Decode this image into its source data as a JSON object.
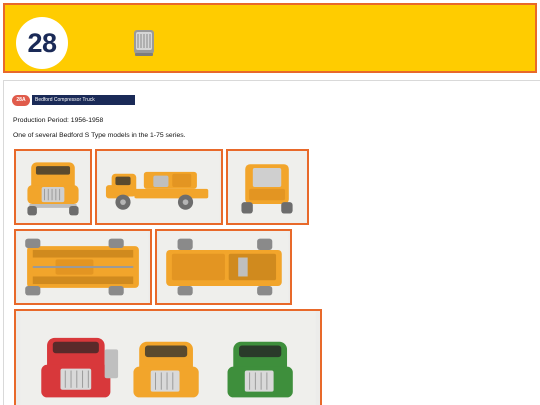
{
  "banner": {
    "number": "28",
    "thumbnail_icon": "truck-grille-icon",
    "colors": {
      "background": "#ffcc00",
      "border": "#e8692a",
      "number_text": "#1a2a57"
    }
  },
  "model": {
    "code": "28A",
    "name": "Bedford Compressor Truck",
    "production_period": "Production Period: 1956-1958",
    "description": "One of several Bedford S Type models in the 1-75 series."
  },
  "photos": [
    {
      "view": "front view",
      "color": "orange"
    },
    {
      "view": "side view",
      "color": "orange"
    },
    {
      "view": "rear view",
      "color": "orange"
    },
    {
      "view": "underside view",
      "color": "orange"
    },
    {
      "view": "underside angled view",
      "color": "orange"
    },
    {
      "view": "group front view",
      "colors": [
        "red",
        "orange",
        "green"
      ]
    }
  ],
  "colors": {
    "accent": "#e8692a",
    "badge": "#e05b4b",
    "namebar": "#1a2a57",
    "truck_orange": "#f2a52b"
  }
}
